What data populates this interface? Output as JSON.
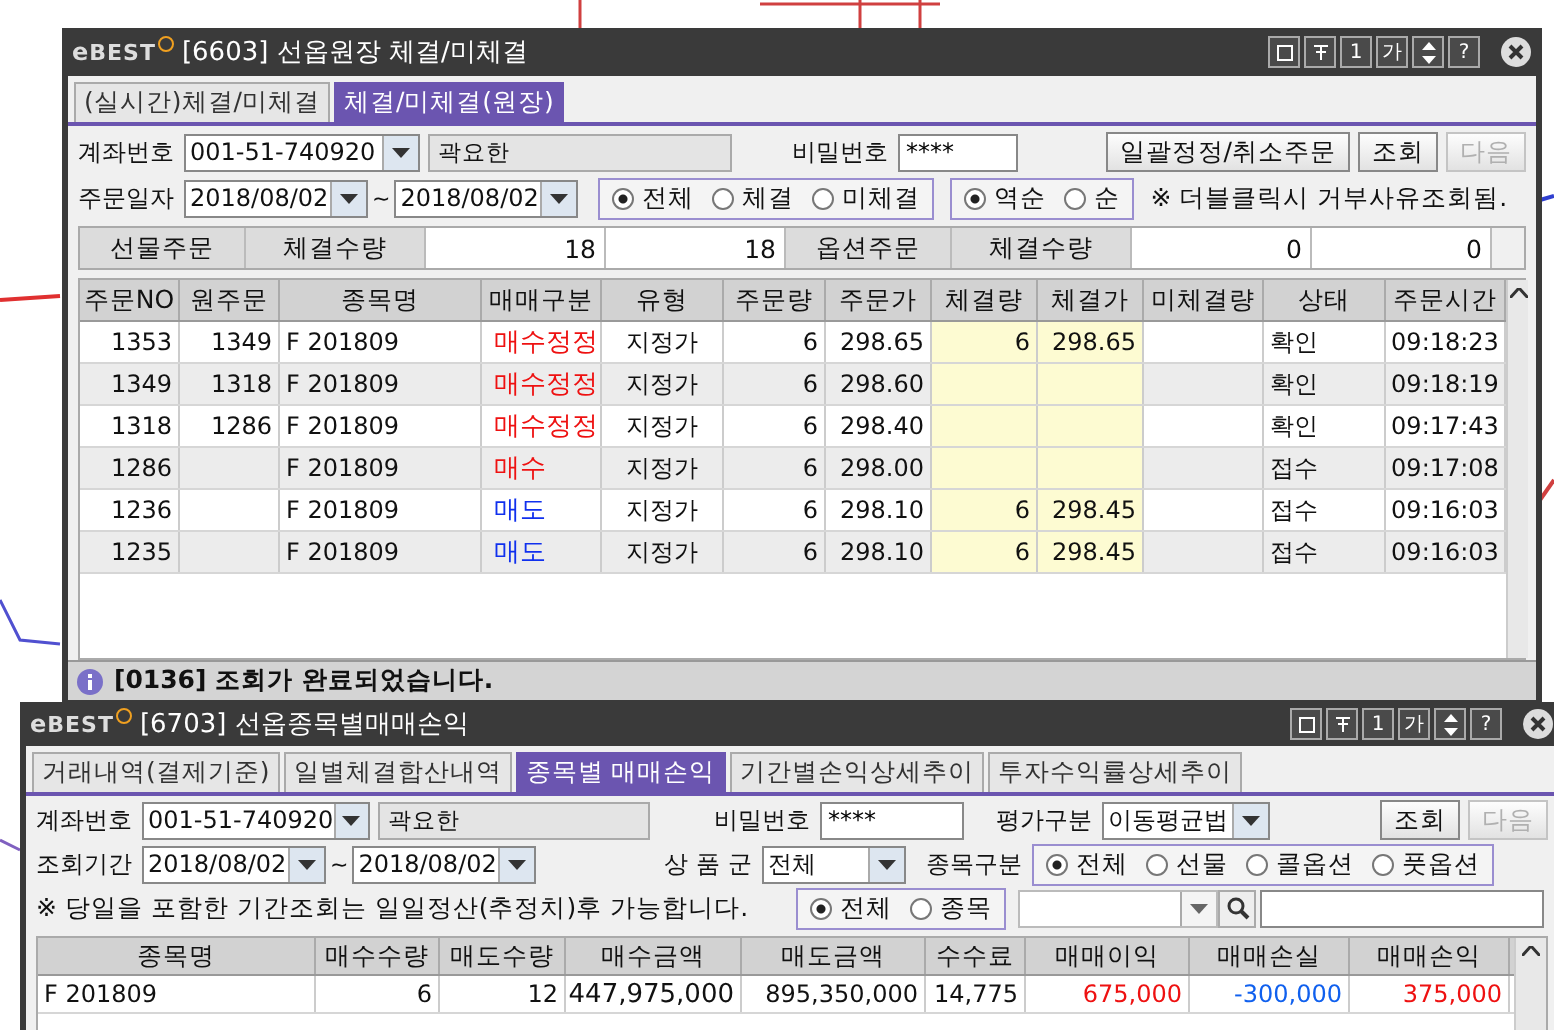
{
  "order_window": {
    "logo": {
      "prefix": "e",
      "name": "BEST"
    },
    "title": "[6603] 선옵원장 체결/미체결",
    "title_buttons": [
      "1",
      "가",
      "?"
    ],
    "tabs": [
      {
        "label": "(실시간)체결/미체결",
        "selected": false
      },
      {
        "label": "체결/미체결(원장)",
        "selected": true
      }
    ],
    "account": {
      "label": "계좌번호",
      "value": "001-51-740920",
      "name": "곽요한"
    },
    "password": {
      "label": "비밀번호",
      "value": "****"
    },
    "buttons": [
      {
        "label": "일괄정정/취소주문",
        "disabled": false
      },
      {
        "label": "조회",
        "disabled": false
      },
      {
        "label": "다음",
        "disabled": true
      }
    ],
    "date": {
      "label": "주문일자",
      "from": "2018/08/02",
      "separator": "~",
      "to": "2018/08/02"
    },
    "filter": [
      {
        "label": "전체",
        "selected": true
      },
      {
        "label": "체결",
        "selected": false
      },
      {
        "label": "미체결",
        "selected": false
      }
    ],
    "sort": [
      {
        "label": "역순",
        "selected": true
      },
      {
        "label": "순",
        "selected": false
      }
    ],
    "note": "※ 더블클릭시 거부사유조회됨.",
    "summary": [
      {
        "kind": "head",
        "text": "선물주문"
      },
      {
        "kind": "head",
        "text": "체결수량"
      },
      {
        "kind": "value",
        "text": "18"
      },
      {
        "kind": "value",
        "text": "18"
      },
      {
        "kind": "head",
        "text": "옵션주문"
      },
      {
        "kind": "head",
        "text": "체결수량"
      },
      {
        "kind": "value",
        "text": "0"
      },
      {
        "kind": "value",
        "text": "0"
      }
    ],
    "columns": [
      "주문NO",
      "원주문",
      "종목명",
      "매매구분",
      "유형",
      "주문량",
      "주문가",
      "체결량",
      "체결가",
      "미체결량",
      "상태",
      "주문시간"
    ],
    "rows": [
      {
        "color": "#ee1111",
        "cells": [
          "1353",
          "1349",
          "F 201809",
          "매수정정",
          "지정가",
          "6",
          "298.65",
          "6",
          "298.65",
          "",
          "확인",
          "09:18:23"
        ]
      },
      {
        "color": "#ee1111",
        "cells": [
          "1349",
          "1318",
          "F 201809",
          "매수정정",
          "지정가",
          "6",
          "298.60",
          "",
          "",
          "",
          "확인",
          "09:18:19"
        ]
      },
      {
        "color": "#ee1111",
        "cells": [
          "1318",
          "1286",
          "F 201809",
          "매수정정",
          "지정가",
          "6",
          "298.40",
          "",
          "",
          "",
          "확인",
          "09:17:43"
        ]
      },
      {
        "color": "#ee1111",
        "cells": [
          "1286",
          "",
          "F 201809",
          "매수",
          "지정가",
          "6",
          "298.00",
          "",
          "",
          "",
          "접수",
          "09:17:08"
        ]
      },
      {
        "color": "#1030ee",
        "cells": [
          "1236",
          "",
          "F 201809",
          "매도",
          "지정가",
          "6",
          "298.10",
          "6",
          "298.45",
          "",
          "접수",
          "09:16:03"
        ]
      },
      {
        "color": "#1030ee",
        "cells": [
          "1235",
          "",
          "F 201809",
          "매도",
          "지정가",
          "6",
          "298.10",
          "6",
          "298.45",
          "",
          "접수",
          "09:16:03"
        ]
      }
    ],
    "status": "[0136] 조회가 완료되었습니다."
  },
  "pnl_window": {
    "logo": {
      "prefix": "e",
      "name": "BEST"
    },
    "title": "[6703] 선옵종목별매매손익",
    "title_buttons": [
      "1",
      "가",
      "?"
    ],
    "tabs": [
      {
        "label": "거래내역(결제기준)",
        "selected": false
      },
      {
        "label": "일별체결합산내역",
        "selected": false
      },
      {
        "label": "종목별 매매손익",
        "selected": true
      },
      {
        "label": "기간별손익상세추이",
        "selected": false
      },
      {
        "label": "투자수익률상세추이",
        "selected": false
      }
    ],
    "account": {
      "label": "계좌번호",
      "value": "001-51-740920",
      "name": "곽요한"
    },
    "password": {
      "label": "비밀번호",
      "value": "****"
    },
    "valuation": {
      "label": "평가구분",
      "value": "이동평균법"
    },
    "buttons": [
      {
        "label": "조회",
        "disabled": false
      },
      {
        "label": "다음",
        "disabled": true
      }
    ],
    "period": {
      "label": "조회기간",
      "from": "2018/08/02",
      "separator": "~",
      "to": "2018/08/02"
    },
    "product_group": {
      "label": "상 품 군",
      "value": "전체"
    },
    "instrument_type": {
      "label": "종목구분",
      "options": [
        {
          "label": "전체",
          "selected": true
        },
        {
          "label": "선물",
          "selected": false
        },
        {
          "label": "콜옵션",
          "selected": false
        },
        {
          "label": "풋옵션",
          "selected": false
        }
      ]
    },
    "note": "※ 당일을 포함한 기간조회는 일일정산(추정치)후 가능합니다.",
    "scope": [
      {
        "label": "전체",
        "selected": true
      },
      {
        "label": "종목",
        "selected": false
      }
    ],
    "columns": [
      {
        "label": "종목명"
      },
      {
        "label": "매수수량"
      },
      {
        "label": "매도수량"
      },
      {
        "label": "매수금액"
      },
      {
        "label": "매도금액"
      },
      {
        "label": "수수료"
      },
      {
        "label": "매매이익",
        "color": "#ee1111"
      },
      {
        "label": "매매손실",
        "color": "#1060ee"
      },
      {
        "label": "매매손익",
        "color": "#ee1111"
      }
    ],
    "rows": [
      [
        "F 201809",
        "6",
        "12",
        "447,975,000",
        "895,350,000",
        "14,775",
        "675,000",
        "-300,000",
        "375,000"
      ]
    ]
  }
}
